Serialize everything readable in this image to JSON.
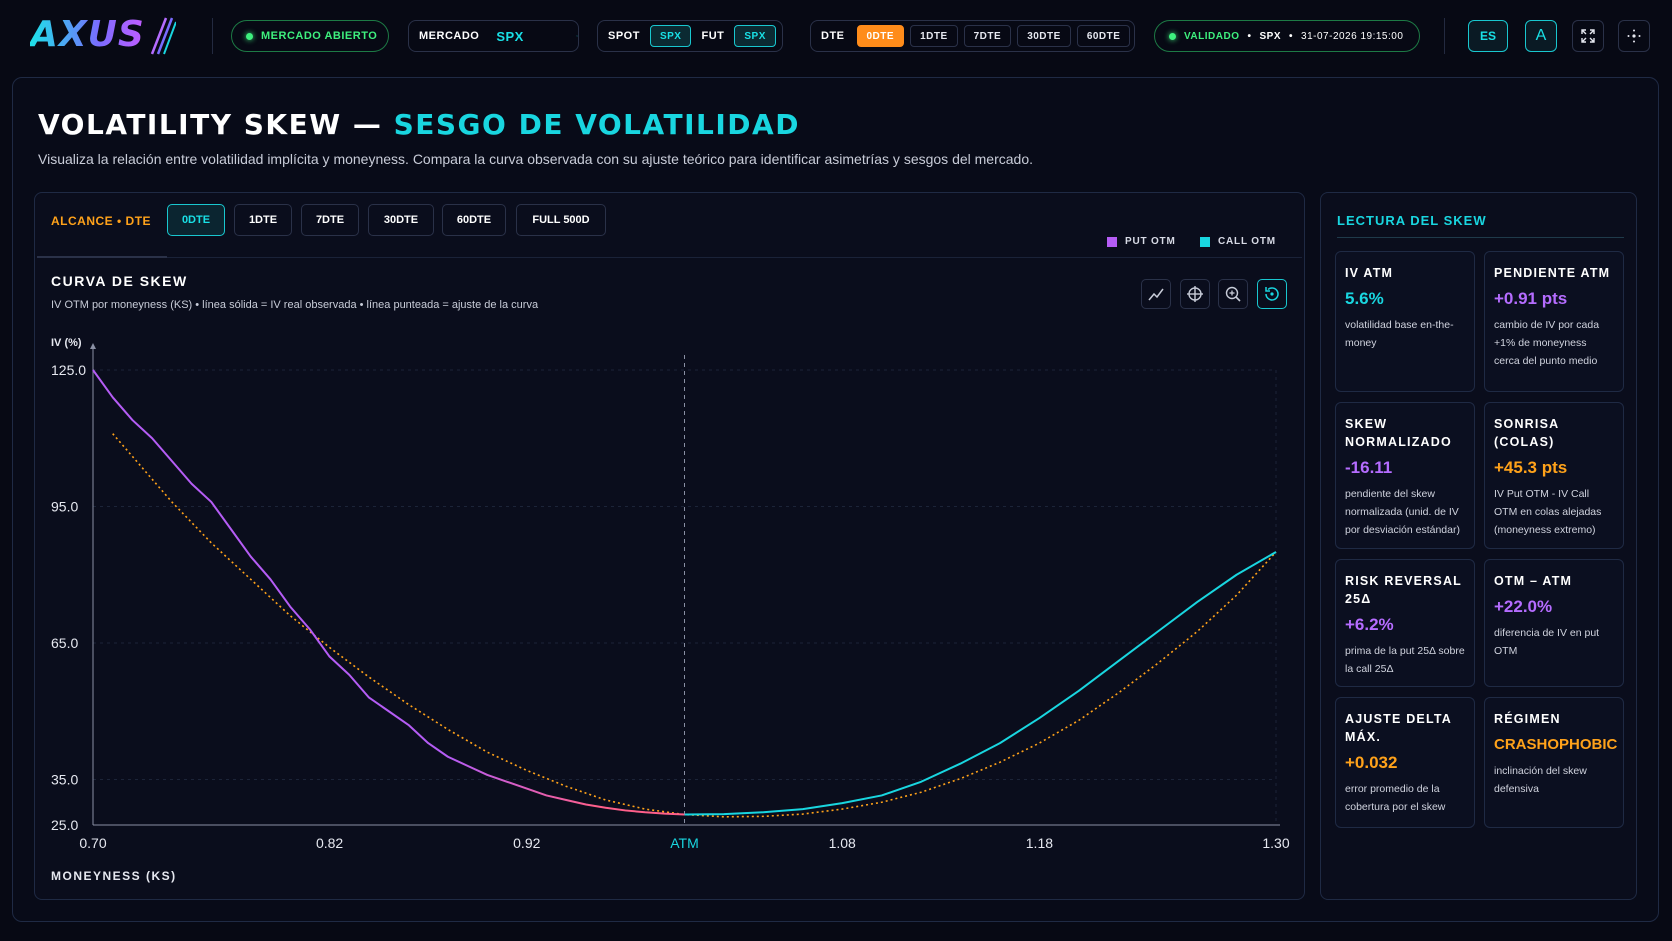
{
  "app": {
    "logo_text": "AXUS"
  },
  "topbar": {
    "market_status": "MERCADO ABIERTO",
    "market_label": "MERCADO",
    "market_value": "SPX",
    "spot_label": "SPOT",
    "spot_value": "SPX",
    "fut_label": "FUT",
    "fut_value": "SPX",
    "dte_label": "DTE",
    "dte_options": [
      "0DTE",
      "1DTE",
      "7DTE",
      "30DTE",
      "60DTE"
    ],
    "dte_selected": "0DTE",
    "validation_status": "VALIDADO",
    "validation_symbol": "SPX",
    "validation_timestamp": "31-07-2026 19:15:00",
    "lang_button": "ES",
    "font_button": "A"
  },
  "page": {
    "title_main": "VOLATILITY SKEW — ",
    "title_accent": "SESGO DE VOLATILIDAD",
    "subtitle": "Visualiza la relación entre volatilidad implícita y moneyness. Compara la curva observada con su ajuste teórico para identificar asimetrías y sesgos del mercado."
  },
  "scope": {
    "label": "ALCANCE • DTE",
    "options": [
      "0DTE",
      "1DTE",
      "7DTE",
      "30DTE",
      "60DTE",
      "FULL 500D"
    ],
    "selected": "0DTE"
  },
  "chart_panel": {
    "title": "CURVA DE SKEW",
    "subtitle": "IV OTM por moneyness (KS) • línea sólida = IV real observada • línea punteada = ajuste de la curva",
    "legend": [
      {
        "name": "PUT OTM",
        "color": "#b55cf5"
      },
      {
        "name": "CALL OTM",
        "color": "#19d6e0"
      }
    ],
    "tools": [
      "line-chart-icon",
      "crosshair-icon",
      "zoom-icon",
      "reset-view-icon"
    ]
  },
  "chart_data": {
    "type": "line",
    "xlabel": "MONEYNESS (KS)",
    "ylabel": "IV (%)",
    "xlim": [
      0.7,
      1.3
    ],
    "ylim": [
      25.0,
      125.0
    ],
    "x_ticks": [
      {
        "value": 0.7,
        "label": "0.70"
      },
      {
        "value": 0.82,
        "label": "0.82"
      },
      {
        "value": 0.92,
        "label": "0.92"
      },
      {
        "value": 1.0,
        "label": "ATM"
      },
      {
        "value": 1.08,
        "label": "1.08"
      },
      {
        "value": 1.18,
        "label": "1.18"
      },
      {
        "value": 1.3,
        "label": "1.30"
      }
    ],
    "y_ticks": [
      {
        "value": 125.0,
        "label": "125.0"
      },
      {
        "value": 95.0,
        "label": "95.0"
      },
      {
        "value": 65.0,
        "label": "65.0"
      },
      {
        "value": 35.0,
        "label": "35.0"
      },
      {
        "value": 25.0,
        "label": "25.0"
      }
    ],
    "atm_x": 1.0,
    "grid": true,
    "series": [
      {
        "name": "PUT OTM",
        "style": "solid",
        "color": "#b55cf5",
        "x": [
          0.7,
          0.71,
          0.72,
          0.73,
          0.74,
          0.75,
          0.76,
          0.77,
          0.78,
          0.79,
          0.8,
          0.81,
          0.82,
          0.83,
          0.84,
          0.85,
          0.86,
          0.87,
          0.88,
          0.89,
          0.9,
          0.91,
          0.92,
          0.93,
          0.94,
          0.95,
          0.96,
          0.97,
          0.98,
          0.99,
          1.0
        ],
        "y": [
          125.0,
          119.0,
          114.0,
          110.0,
          105.0,
          100.0,
          96.0,
          90.0,
          84.0,
          79.0,
          73.0,
          68.0,
          62.0,
          58.0,
          53.0,
          50.0,
          47.0,
          43.0,
          40.0,
          38.0,
          36.0,
          34.5,
          33.0,
          31.5,
          30.5,
          29.5,
          28.8,
          28.2,
          27.8,
          27.5,
          27.3
        ]
      },
      {
        "name": "CALL OTM",
        "style": "solid",
        "color": "#19d6e0",
        "x": [
          1.0,
          1.02,
          1.04,
          1.06,
          1.08,
          1.1,
          1.12,
          1.14,
          1.16,
          1.18,
          1.2,
          1.22,
          1.24,
          1.26,
          1.28,
          1.3
        ],
        "y": [
          27.3,
          27.4,
          27.8,
          28.5,
          29.8,
          31.5,
          34.5,
          38.5,
          43.0,
          48.5,
          54.5,
          61.0,
          67.5,
          74.0,
          80.0,
          85.0
        ]
      },
      {
        "name": "AJUSTE",
        "style": "dotted",
        "color": "#ffa21a",
        "x": [
          0.71,
          0.72,
          0.74,
          0.76,
          0.78,
          0.8,
          0.82,
          0.84,
          0.86,
          0.88,
          0.9,
          0.92,
          0.94,
          0.96,
          0.98,
          1.0,
          1.02,
          1.04,
          1.06,
          1.08,
          1.1,
          1.12,
          1.14,
          1.16,
          1.18,
          1.2,
          1.22,
          1.24,
          1.26,
          1.28,
          1.3
        ],
        "y": [
          111.0,
          106.0,
          96.0,
          87.0,
          79.0,
          71.0,
          64.0,
          57.5,
          51.5,
          46.0,
          41.0,
          37.0,
          33.5,
          30.5,
          28.5,
          27.3,
          26.8,
          26.9,
          27.4,
          28.5,
          30.0,
          32.2,
          35.2,
          38.8,
          43.0,
          48.0,
          54.0,
          60.5,
          67.5,
          75.5,
          85.0
        ]
      }
    ]
  },
  "side": {
    "title": "LECTURA DEL SKEW",
    "cards": [
      {
        "label": "IV ATM",
        "value": "5.6%",
        "color": "#19d6e0",
        "desc": "volatilidad base en-the-money"
      },
      {
        "label": "PENDIENTE ATM",
        "value": "+0.91 pts",
        "color": "#b56cff",
        "desc": "cambio de IV por cada +1% de moneyness cerca del punto medio"
      },
      {
        "label": "SKEW NORMALIZADO",
        "value": "-16.11",
        "color": "#b56cff",
        "desc": "pendiente del skew normalizada (unid. de IV por desviación estándar)"
      },
      {
        "label": "SONRISA (COLAS)",
        "value": "+45.3 pts",
        "color": "#ffa21a",
        "desc": "IV Put OTM - IV Call OTM en colas alejadas (moneyness extremo)"
      },
      {
        "label": "RISK REVERSAL 25Δ",
        "value": "+6.2%",
        "color": "#b56cff",
        "desc": "prima de la put 25Δ sobre la call 25Δ"
      },
      {
        "label": "OTM – ATM",
        "value": "+22.0%",
        "color": "#b56cff",
        "desc": "diferencia de IV en put OTM"
      },
      {
        "label": "AJUSTE DELTA MÁX.",
        "value": "+0.032",
        "color": "#ffa21a",
        "desc": "error promedio de la cobertura por el skew"
      },
      {
        "label": "RÉGIMEN",
        "value": "CRASHOPHOBIC",
        "color": "#ffa21a",
        "desc": "inclinación del skew defensiva"
      }
    ]
  }
}
